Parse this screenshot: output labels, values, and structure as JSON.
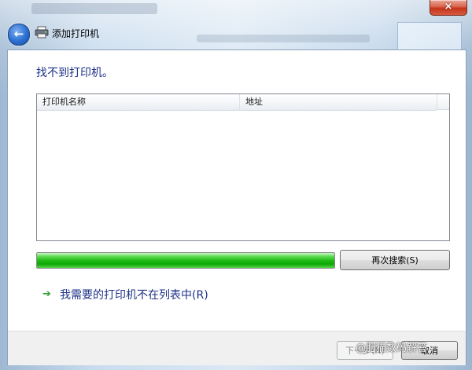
{
  "window": {
    "close_glyph": "×",
    "title": "添加打印机",
    "back_glyph": "←"
  },
  "main": {
    "heading": "找不到打印机。",
    "list": {
      "columns": [
        "打印机名称",
        "地址"
      ]
    },
    "progress": {
      "fraction": 1.0,
      "color": "#18b70e"
    },
    "search_again_label": "再次搜索(S)",
    "not_listed_link": "我需要的打印机不在列表中(R)",
    "link_arrow_glyph": "➔"
  },
  "footer": {
    "next_label": "下一步(N)",
    "cancel_label": "取消"
  },
  "watermark": "@肥猫数码解答",
  "icons": {
    "title": "printer-icon",
    "back": "back-arrow-icon",
    "close": "close-icon",
    "link": "green-arrow-icon"
  }
}
